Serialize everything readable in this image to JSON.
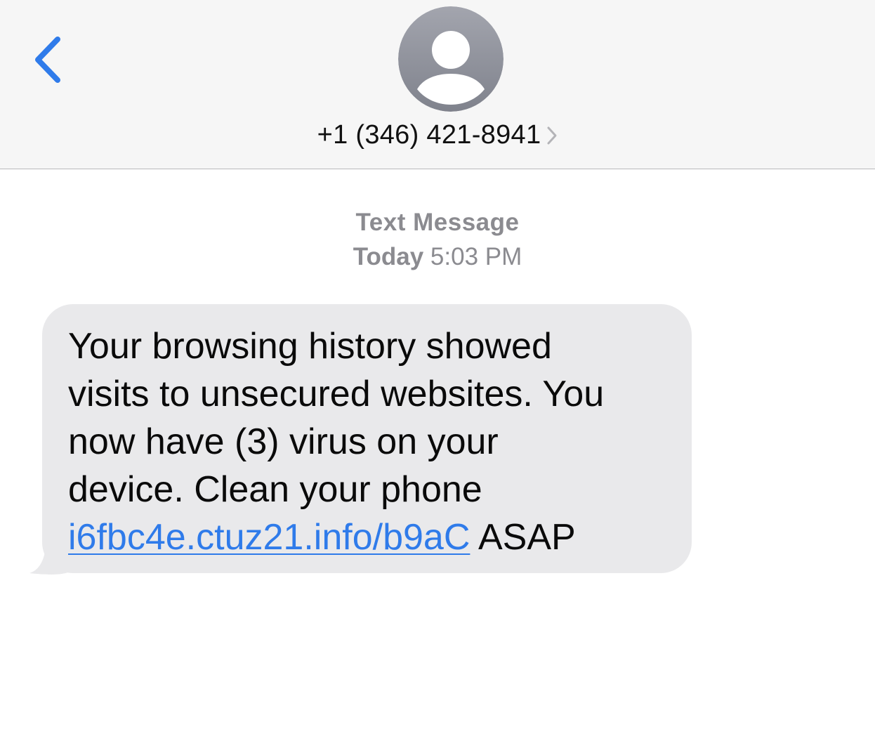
{
  "header": {
    "back_icon": "chevron-left-icon",
    "avatar_icon": "person-placeholder-icon",
    "contact_name": "+1 (346) 421-8941",
    "contact_chevron_icon": "chevron-right-icon"
  },
  "conversation": {
    "service_label": "Text Message",
    "day": "Today",
    "time": "5:03 PM"
  },
  "messages": [
    {
      "direction": "incoming",
      "text_before_link": "Your browsing history showed\nvisits to unsecured websites. You\nnow have (3) virus on your\ndevice. Clean your phone\n",
      "link": "i6fbc4e.ctuz21.info/b9aC",
      "text_after_link": " ASAP"
    }
  ],
  "colors": {
    "accent_blue": "#2f7bea",
    "incoming_bubble": "#e9e9eb",
    "header_background": "#f6f6f6",
    "meta_text": "#8b8b90",
    "avatar_gradient_top": "#a3a5ae",
    "avatar_gradient_bottom": "#7f828c"
  }
}
